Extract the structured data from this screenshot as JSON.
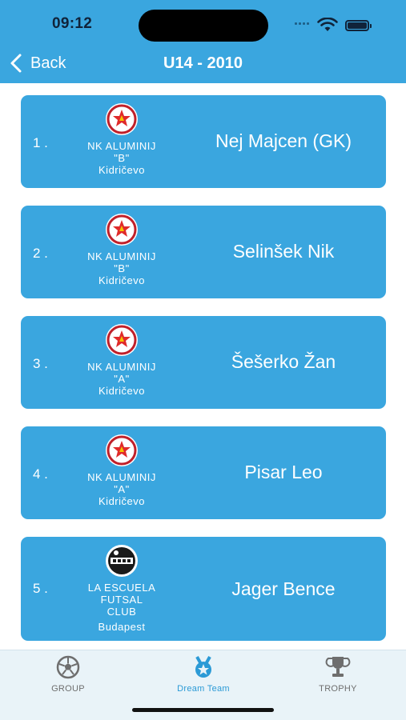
{
  "status_bar": {
    "time": "09:12"
  },
  "header": {
    "back_label": "Back",
    "title": "U14 - 2010"
  },
  "players": [
    {
      "rank": "1 .",
      "club_lines": [
        "NK ALUMINIJ",
        "\"B\""
      ],
      "city": "Kidričevo",
      "name": "Nej Majcen (GK)",
      "logo": "aluminij-crest"
    },
    {
      "rank": "2 .",
      "club_lines": [
        "NK ALUMINIJ",
        "\"B\""
      ],
      "city": "Kidričevo",
      "name": "Selinšek Nik",
      "logo": "aluminij-crest"
    },
    {
      "rank": "3 .",
      "club_lines": [
        "NK ALUMINIJ",
        "\"A\""
      ],
      "city": "Kidričevo",
      "name": "Šešerko Žan",
      "logo": "aluminij-crest"
    },
    {
      "rank": "4 .",
      "club_lines": [
        "NK ALUMINIJ",
        "\"A\""
      ],
      "city": "Kidričevo",
      "name": "Pisar Leo",
      "logo": "aluminij-crest"
    },
    {
      "rank": "5 .",
      "club_lines": [
        "LA ESCUELA",
        "FUTSAL",
        "CLUB"
      ],
      "city": "Budapest",
      "name": "Jager Bence",
      "logo": "escuela-crest"
    }
  ],
  "tabbar": {
    "tabs": [
      {
        "label": "GROUP",
        "icon": "soccer-ball-icon",
        "active": false
      },
      {
        "label": "Dream Team",
        "icon": "medal-star-icon",
        "active": true
      },
      {
        "label": "TROPHY",
        "icon": "trophy-icon",
        "active": false
      }
    ]
  },
  "colors": {
    "accent": "#3aa6df",
    "active_tab": "#2b9ad6",
    "inactive_tab": "#6e6e6e",
    "card_text": "#ffffff"
  }
}
